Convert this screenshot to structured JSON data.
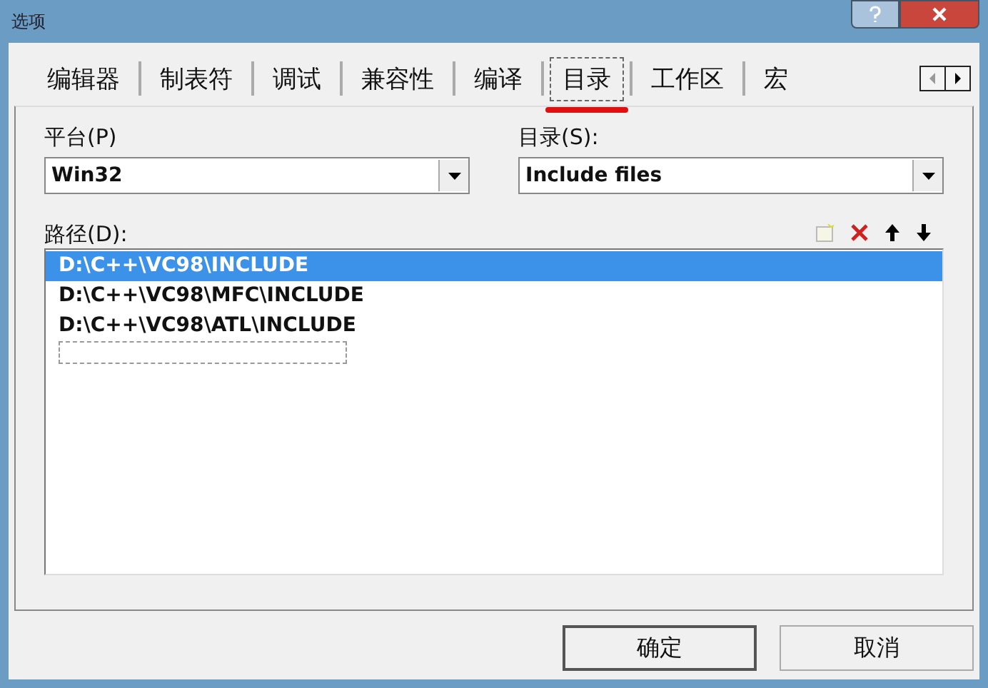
{
  "window": {
    "title": "选项"
  },
  "tabs": [
    {
      "label": "编辑器",
      "selected": false
    },
    {
      "label": "制表符",
      "selected": false
    },
    {
      "label": "调试",
      "selected": false
    },
    {
      "label": "兼容性",
      "selected": false
    },
    {
      "label": "编译",
      "selected": false
    },
    {
      "label": "目录",
      "selected": true
    },
    {
      "label": "工作区",
      "selected": false
    },
    {
      "label": "宏",
      "selected": false
    }
  ],
  "platform": {
    "label": "平台(P)",
    "value": "Win32"
  },
  "directory": {
    "label": "目录(S):",
    "value": "Include files"
  },
  "paths": {
    "label": "路径(D):",
    "items": [
      {
        "text": "D:\\C++\\VC98\\INCLUDE",
        "selected": true
      },
      {
        "text": "D:\\C++\\VC98\\MFC\\INCLUDE",
        "selected": false
      },
      {
        "text": "D:\\C++\\VC98\\ATL\\INCLUDE",
        "selected": false
      }
    ]
  },
  "buttons": [
    "确定",
    "取消"
  ]
}
